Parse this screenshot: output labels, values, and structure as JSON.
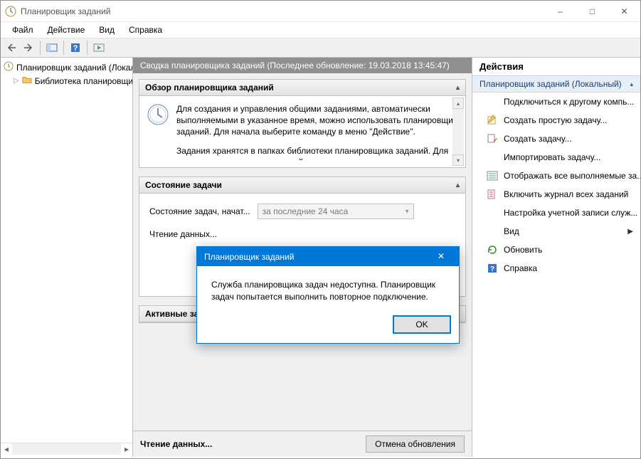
{
  "window": {
    "title": "Планировщик заданий"
  },
  "menu": {
    "file": "Файл",
    "action": "Действие",
    "view": "Вид",
    "help": "Справка"
  },
  "tree": {
    "root": "Планировщик заданий (Локальный)",
    "library": "Библиотека планировщика заданий"
  },
  "summary": {
    "header": "Сводка планировщика заданий (Последнее обновление: 19.03.2018 13:45:47)",
    "overview_title": "Обзор планировщика заданий",
    "overview_p1": "Для создания и управления общими заданиями, автоматически выполняемыми в указанное время, можно использовать планировщик заданий. Для начала выберите команду в меню \"Действие\".",
    "overview_p2": "Задания хранятся в папках библиотеки планировщика заданий. Для просмотра или выполнения действия с",
    "state_title": "Состояние задачи",
    "state_label": "Состояние задач, начат...",
    "state_combo": "за последние 24 часа",
    "reading_label": "Чтение данных...",
    "active_title": "Активные задачи",
    "footer_reading": "Чтение данных...",
    "cancel_btn": "Отмена обновления"
  },
  "actions": {
    "title": "Действия",
    "group": "Планировщик заданий (Локальный)",
    "items": {
      "connect": "Подключиться к другому компь...",
      "create_basic": "Создать простую задачу...",
      "create_task": "Создать задачу...",
      "import": "Импортировать задачу...",
      "show_running": "Отображать все выполняемые за...",
      "enable_log": "Включить журнал всех заданий",
      "account_config": "Настройка учетной записи служ...",
      "view": "Вид",
      "refresh": "Обновить",
      "help": "Справка"
    }
  },
  "dialog": {
    "title": "Планировщик заданий",
    "message": "Служба планировщика задач недоступна.  Планировщик задач попытается выполнить повторное подключение.",
    "ok": "OK"
  }
}
